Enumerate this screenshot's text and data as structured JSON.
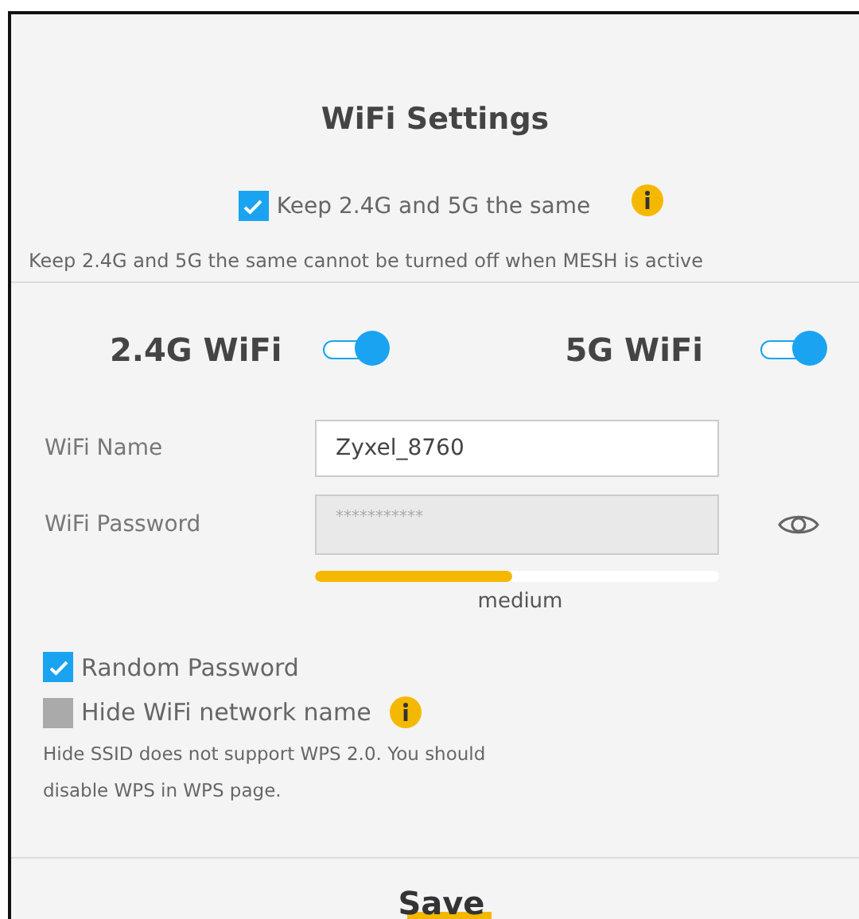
{
  "title": "WiFi Settings",
  "sync": {
    "label": "Keep 2.4G and 5G the same",
    "checked": true,
    "info": true,
    "note": "Keep 2.4G and 5G the same cannot be turned off when MESH is active"
  },
  "bands": [
    {
      "label": "2.4G WiFi",
      "on": true
    },
    {
      "label": "5G WiFi",
      "on": true
    }
  ],
  "fields": [
    {
      "label": "WiFi Name",
      "value": "Zyxel_8760",
      "disabled": false,
      "reveal_toggle": false
    },
    {
      "label": "WiFi Password",
      "value": "***********",
      "disabled": true,
      "reveal_toggle": true
    }
  ],
  "strength": {
    "level": 0.49,
    "label": "medium"
  },
  "options": [
    {
      "label": "Random Password",
      "checked": true,
      "info": false
    },
    {
      "label": "Hide WiFi network name",
      "checked": false,
      "info": true
    }
  ],
  "note": "Hide SSID does not support WPS 2.0. You should disable WPS in WPS page.",
  "save": "Save"
}
